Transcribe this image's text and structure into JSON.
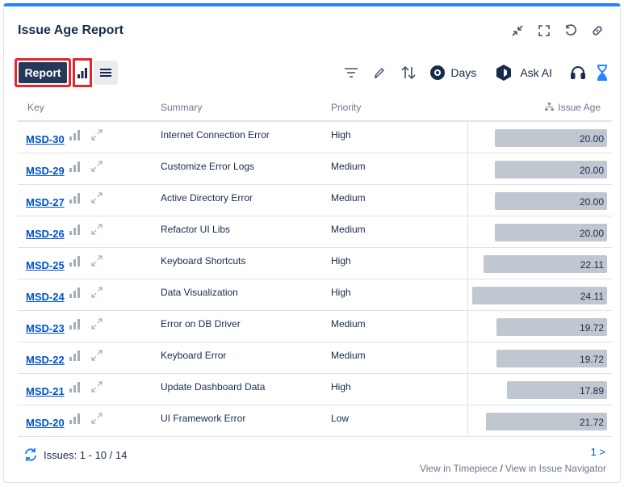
{
  "title": "Issue Age Report",
  "toolbar": {
    "report_label": "Report",
    "days_label": "Days",
    "ask_ai_label": "Ask AI"
  },
  "columns": {
    "key": "Key",
    "summary": "Summary",
    "priority": "Priority",
    "issue_age": "Issue Age"
  },
  "rows": [
    {
      "key": "MSD-30",
      "summary": "Internet Connection Error",
      "priority": "High",
      "age": "20.00",
      "age_value": 20.0
    },
    {
      "key": "MSD-29",
      "summary": "Customize Error Logs",
      "priority": "Medium",
      "age": "20.00",
      "age_value": 20.0
    },
    {
      "key": "MSD-27",
      "summary": "Active Directory Error",
      "priority": "Medium",
      "age": "20.00",
      "age_value": 20.0
    },
    {
      "key": "MSD-26",
      "summary": "Refactor UI Libs",
      "priority": "Medium",
      "age": "20.00",
      "age_value": 20.0
    },
    {
      "key": "MSD-25",
      "summary": "Keyboard Shortcuts",
      "priority": "High",
      "age": "22.11",
      "age_value": 22.11
    },
    {
      "key": "MSD-24",
      "summary": "Data Visualization",
      "priority": "High",
      "age": "24.11",
      "age_value": 24.11
    },
    {
      "key": "MSD-23",
      "summary": "Error on DB Driver",
      "priority": "Medium",
      "age": "19.72",
      "age_value": 19.72
    },
    {
      "key": "MSD-22",
      "summary": "Keyboard Error",
      "priority": "Medium",
      "age": "19.72",
      "age_value": 19.72
    },
    {
      "key": "MSD-21",
      "summary": "Update Dashboard Data",
      "priority": "High",
      "age": "17.89",
      "age_value": 17.89
    },
    {
      "key": "MSD-20",
      "summary": "UI Framework Error",
      "priority": "Low",
      "age": "21.72",
      "age_value": 21.72
    }
  ],
  "footer": {
    "issues_label": "Issues: 1 - 10 / 14",
    "pager": "1 >",
    "view_timepiece": "View in Timepiece",
    "separator": "/",
    "view_navigator": "View in Issue Navigator"
  },
  "colors": {
    "accent": "#2684ff",
    "report_button": "#253858",
    "highlight": "#e5262d",
    "bar": "#c1c7d0",
    "link": "#0052cc"
  }
}
